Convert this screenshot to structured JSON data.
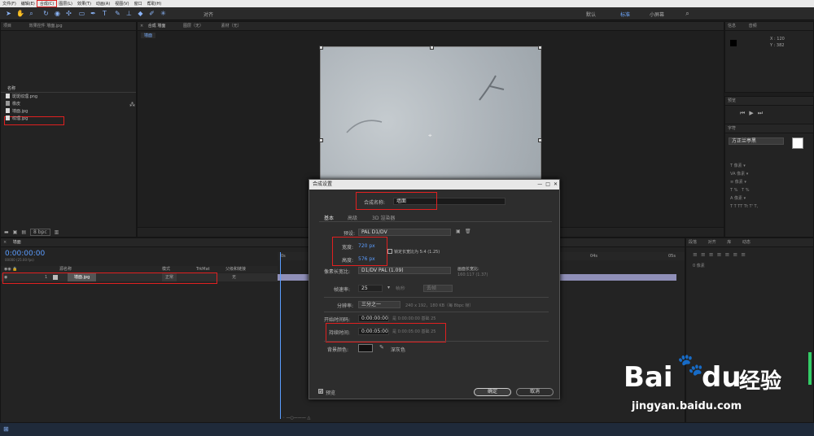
{
  "menubar": {
    "items": [
      "文件(F)",
      "编辑(E)",
      "合成(C)",
      "图层(L)",
      "效果(T)",
      "动画(A)",
      "视图(V)",
      "窗口",
      "帮助(H)"
    ]
  },
  "toolbar": {
    "align_label": "对齐",
    "workspaces": [
      "默认",
      "标准",
      "小屏幕"
    ]
  },
  "project_panel": {
    "tab": "项目",
    "effects_tab": "效果控件 墙面.jpg",
    "column_name": "名称",
    "items": [
      {
        "name": "斑斑纹理.png",
        "icon": "image-file-icon"
      },
      {
        "name": "橡皮",
        "icon": "composition-icon"
      },
      {
        "name": "墙面.jpg",
        "icon": "image-file-icon"
      },
      {
        "name": "纹理.jpg",
        "icon": "image-file-icon"
      }
    ],
    "bpc": "8 bpc"
  },
  "viewer": {
    "tab_comp": "合成 墙面",
    "tab_layer": "图层（无）",
    "tab_footage": "素材（无）",
    "subtab": "墙面"
  },
  "timeline": {
    "tab": "墙面",
    "timecode": "0:00:00:00",
    "timecode_sub": "00000 (25.00 fps)",
    "columns": {
      "source": "源名称",
      "mode": "模式",
      "trkmat": "TrkMat",
      "parent": "父级和链接"
    },
    "layer": {
      "index": "1",
      "name": "墙面.jpg",
      "mode": "正常",
      "parent": "无"
    },
    "ruler": [
      "0s",
      "04s",
      "05s"
    ]
  },
  "info_panel": {
    "tabs": [
      "信息",
      "音频"
    ],
    "readout": [
      "X : 120",
      "Y : 382"
    ]
  },
  "preview_panel": {
    "tab": "预览"
  },
  "character_panel": {
    "tab": "字符",
    "font": "方正兰亭黑"
  },
  "paragraph_panel": {
    "tabs": [
      "段落",
      "对齐",
      "库",
      "动态"
    ],
    "note": "0 像素"
  },
  "dialog": {
    "title": "合成设置",
    "name_label": "合成名称:",
    "name_value": "墙面",
    "tabs": [
      "基本",
      "高级",
      "3D 渲染器"
    ],
    "preset_label": "预设:",
    "preset_value": "PAL D1/DV",
    "width_label": "宽度:",
    "width_value": "720 px",
    "height_label": "高度:",
    "height_value": "576 px",
    "lock_label": "锁定长宽比为 5:4 (1.25)",
    "par_label": "像素长宽比:",
    "par_value": "D1/DV PAL (1.09)",
    "frame_ar_label": "画面长宽比:",
    "frame_ar_value": "160:117 (1.37)",
    "fps_label": "帧速率:",
    "fps_value": "25",
    "fps_unit": "帧/秒",
    "drop_frame": "丢帧",
    "res_label": "分辨率:",
    "res_value": "三分之一",
    "res_info": "240 x 192，180 KB（每 8bpc 帧）",
    "start_label": "开始时间码:",
    "start_value": "0:00:00:00",
    "start_info": "是 0:00:00:00  基础 25",
    "dur_label": "持续时间:",
    "dur_value": "0:00:05:00",
    "dur_info": "是 0:00:05:00  基础 25",
    "bg_label": "背景颜色:",
    "bg_name": "深灰色",
    "bg_color": "#111111",
    "preview_label": "预览",
    "ok_label": "确定",
    "cancel_label": "取消"
  },
  "watermark": {
    "brand": "Bai",
    "brand2": "du",
    "cn": "经验",
    "url": "jingyan.baidu.com"
  }
}
